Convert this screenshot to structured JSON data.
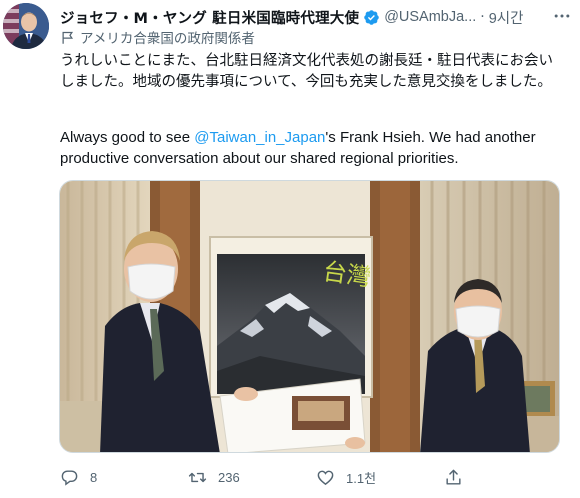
{
  "tweet": {
    "display_name": "ジョセフ・M・ヤング 駐日米国臨時代理大使",
    "handle": "@USAmbJa...",
    "separator": "·",
    "time": "9시간",
    "gov_label": "アメリカ合衆国の政府関係者",
    "text_jp": "うれしいことにまた、台北駐日経済文化代表処の謝長廷・駐日代表にお会いしました。地域の優先事項について、今回も充実した意見交換をしました。",
    "text_en_pre": "Always good to see ",
    "mention": "@Taiwan_in_Japan",
    "text_en_post": "'s Frank Hsieh. We had another productive conversation about our shared regional priorities.",
    "poster_text": "台灣",
    "replies": "8",
    "retweets": "236",
    "likes": "1.1천"
  },
  "colors": {
    "text": "#0f1419",
    "secondary": "#536471",
    "accent": "#1d9bf0"
  },
  "icons": [
    "verified-badge-icon",
    "more-icon",
    "government-flag-icon",
    "reply-icon",
    "retweet-icon",
    "like-icon",
    "share-icon"
  ]
}
